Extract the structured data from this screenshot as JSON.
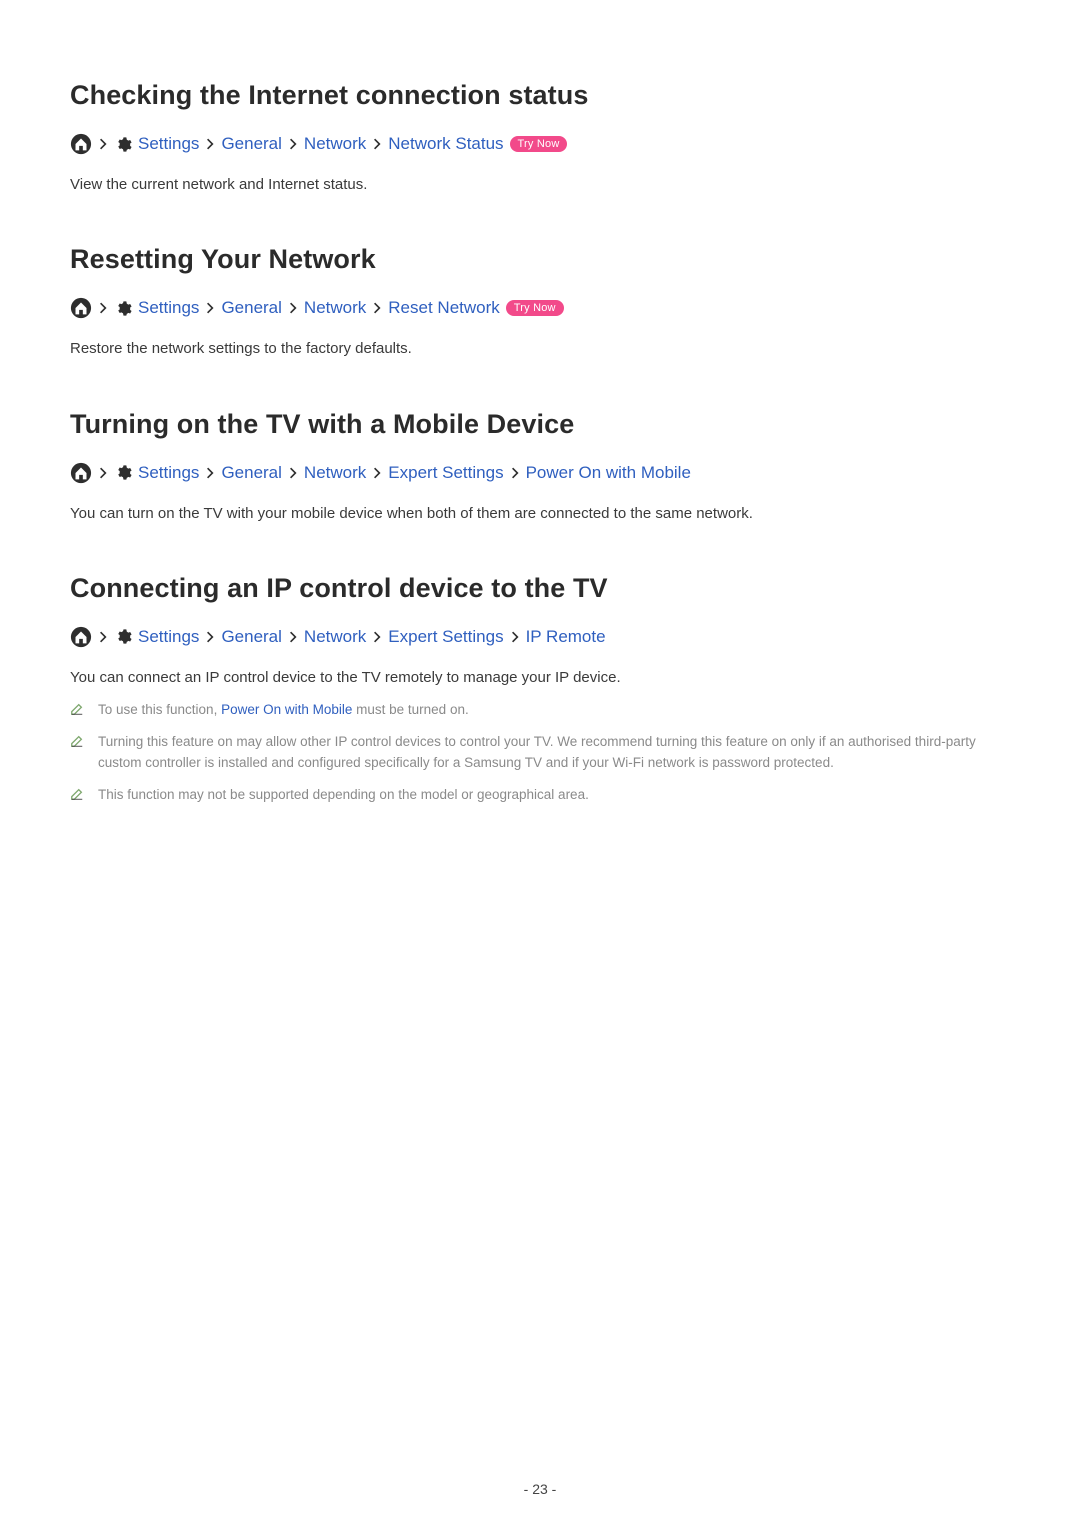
{
  "labels": {
    "settings": "Settings",
    "general": "General",
    "network": "Network",
    "expert_settings": "Expert Settings",
    "try_now": "Try Now"
  },
  "sections": {
    "check": {
      "title": "Checking the Internet connection status",
      "last": "Network Status",
      "body": "View the current network and Internet status."
    },
    "reset": {
      "title": "Resetting Your Network",
      "last": "Reset Network",
      "body": "Restore the network settings to the factory defaults."
    },
    "mobile": {
      "title": "Turning on the TV with a Mobile Device",
      "last": "Power On with Mobile",
      "body": "You can turn on the TV with your mobile device when both of them are connected to the same network."
    },
    "ip": {
      "title": "Connecting an IP control device to the TV",
      "last": "IP Remote",
      "body": "You can connect an IP control device to the TV remotely to manage your IP device.",
      "note1_pre": "To use this function, ",
      "note1_link": "Power On with Mobile",
      "note1_post": " must be turned on.",
      "note2": "Turning this feature on may allow other IP control devices to control your TV. We recommend turning this feature on only if an authorised third-party custom controller is installed and configured specifically for a Samsung TV and if your Wi-Fi network is password protected.",
      "note3": "This function may not be supported depending on the model or geographical area."
    }
  },
  "page_number": "- 23 -"
}
